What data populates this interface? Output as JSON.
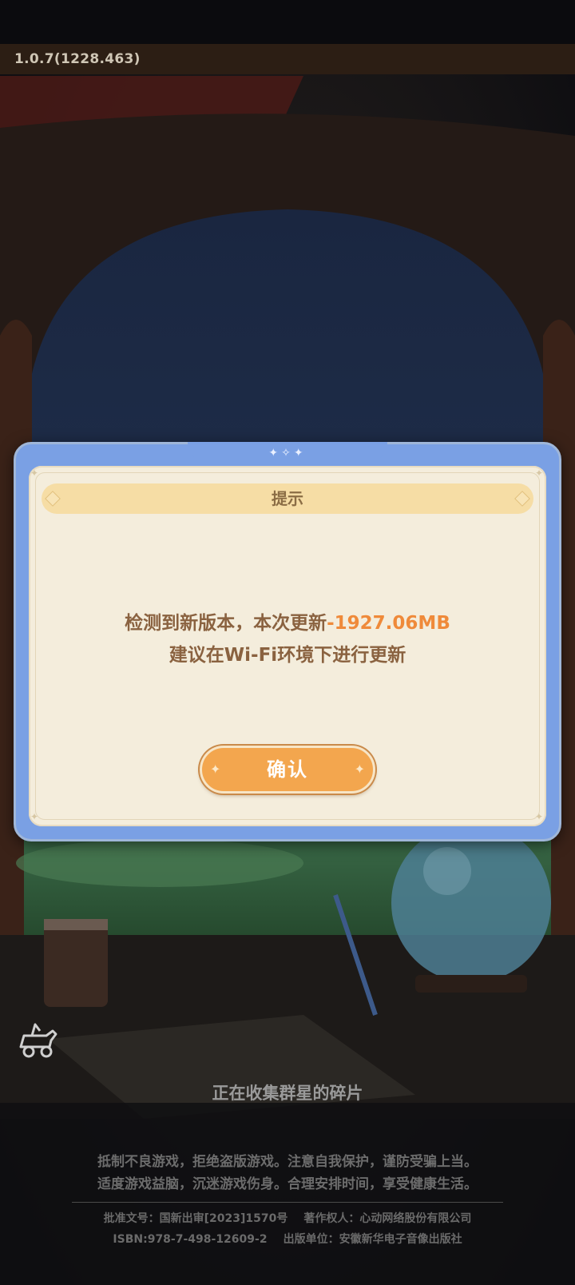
{
  "app": {
    "version": "1.0.7(1228.463)"
  },
  "dialog": {
    "title": "提示",
    "message_prefix": "检测到新版本，本次更新",
    "update_size": "-1927.06MB",
    "message_line2": "建议在Wi-Fi环境下进行更新",
    "confirm_label": "确认"
  },
  "loading": {
    "status_text": "正在收集群星的碎片"
  },
  "footer": {
    "advisory_line1": "抵制不良游戏，拒绝盗版游戏。注意自我保护，谨防受骗上当。",
    "advisory_line2": "适度游戏益脑，沉迷游戏伤身。合理安排时间，享受健康生活。",
    "approval": "批准文号：国新出审[2023]1570号",
    "copyright": "著作权人：心动网络股份有限公司",
    "isbn": "ISBN:978-7-498-12609-2",
    "publisher": "出版单位：安徽新华电子音像出版社"
  },
  "colors": {
    "dialog_frame": "#7aa0e4",
    "dialog_panel": "#f4eddc",
    "title_bar": "#f6dda5",
    "message_text": "#8a6240",
    "size_highlight": "#ef8a3a",
    "confirm_button": "#f3a64e"
  },
  "icons": {
    "cart": "cart-icon"
  }
}
